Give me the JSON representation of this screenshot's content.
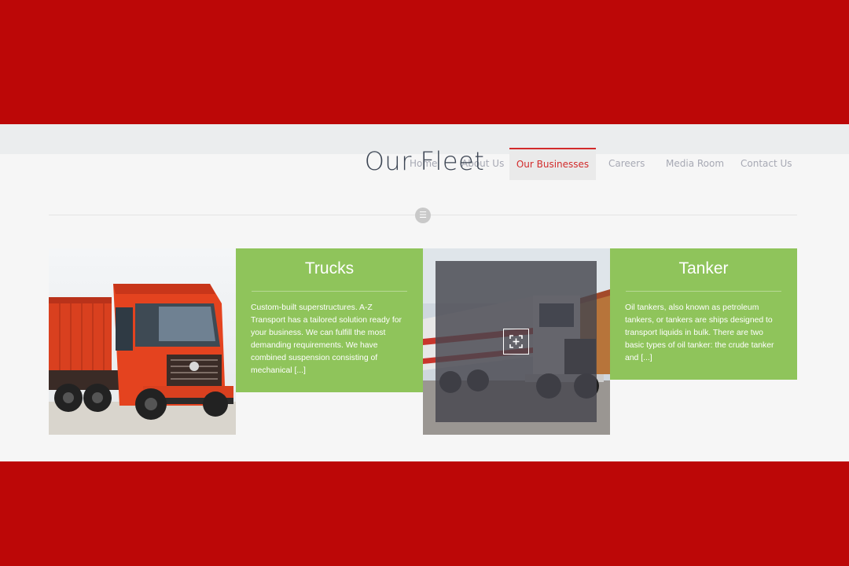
{
  "page": {
    "title": "Our Fleet"
  },
  "nav": {
    "items": [
      {
        "label": "Home",
        "active": false
      },
      {
        "label": "About Us",
        "active": false
      },
      {
        "label": "Our Businesses",
        "active": true
      },
      {
        "label": "Careers",
        "active": false
      },
      {
        "label": "Media Room",
        "active": false
      },
      {
        "label": "Contact Us",
        "active": false
      }
    ]
  },
  "fleet": {
    "cards": [
      {
        "title": "Trucks",
        "text": "Custom-built superstructures. A-Z Transport has a tailored solution ready for your business. We can fulfill the most demanding requirements. We have combined suspension consisting of mechanical [...]",
        "image_icon": "red-truck-image"
      },
      {
        "title": "Tanker",
        "text": "Oil tankers, also known as petroleum tankers, or tankers are ships designed to transport liquids in bulk. There are two basic types of oil tanker: the crude tanker and [...]",
        "image_icon": "tanker-truck-image"
      }
    ]
  },
  "icons": {
    "divider": "menu-icon",
    "zoom": "expand-icon"
  },
  "colors": {
    "brand_red": "#bc0707",
    "card_green": "#8fc45b",
    "nav_active": "#d22b2b"
  }
}
